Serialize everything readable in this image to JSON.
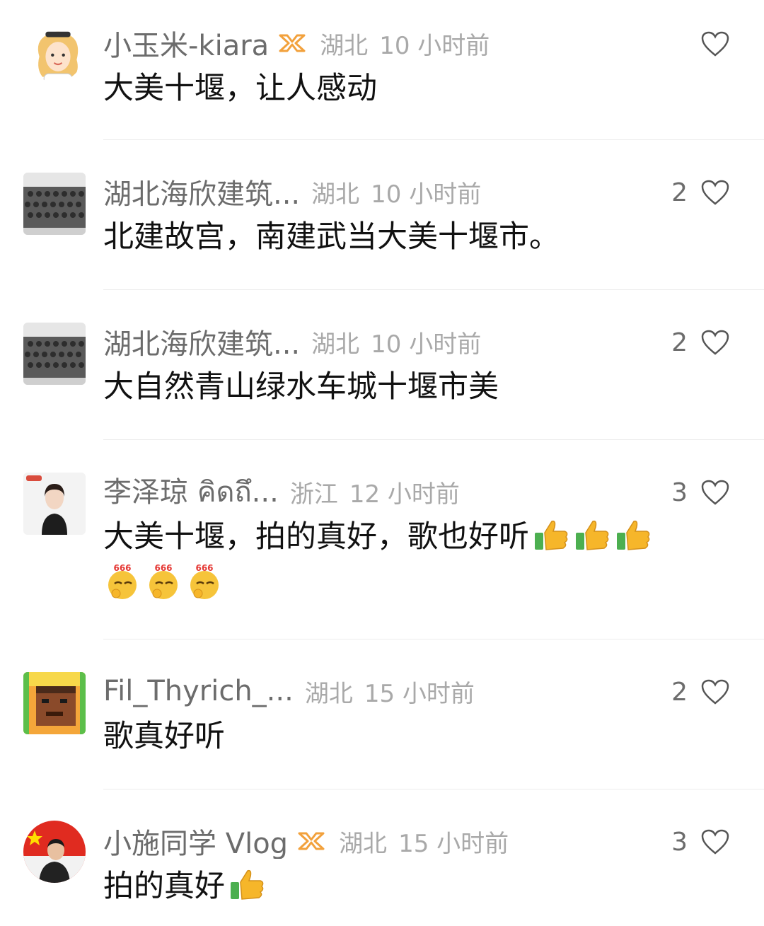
{
  "comments": [
    {
      "name": "小玉米-kiara",
      "verified": true,
      "location": "湖北",
      "time": "10 小时前",
      "text": "大美十堰，让人感动",
      "likes": "",
      "avatar_icon": "cartoon-girl-avatar"
    },
    {
      "name": "湖北海欣建筑...",
      "verified": false,
      "location": "湖北",
      "time": "10 小时前",
      "text": "北建故宫，南建武当大美十堰市。",
      "likes": "2",
      "avatar_icon": "group-photo-avatar"
    },
    {
      "name": "湖北海欣建筑...",
      "verified": false,
      "location": "湖北",
      "time": "10 小时前",
      "text": "大自然青山绿水车城十堰市美",
      "likes": "2",
      "avatar_icon": "group-photo-avatar"
    },
    {
      "name": "李泽琼 คิดถึ...",
      "verified": false,
      "location": "浙江",
      "time": "12 小时前",
      "text": "大美十堰，拍的真好，歌也好听",
      "likes": "3",
      "avatar_icon": "portrait-woman-avatar"
    },
    {
      "name": "Fil_Thyrich_...",
      "verified": false,
      "location": "湖北",
      "time": "15 小时前",
      "text": "歌真好听",
      "likes": "2",
      "avatar_icon": "pixel-art-avatar"
    },
    {
      "name": "小施同学 Vlog",
      "verified": true,
      "location": "湖北",
      "time": "15 小时前",
      "text": "拍的真好",
      "likes": "3",
      "avatar_icon": "man-flag-avatar"
    }
  ],
  "emoji": {
    "thumbs_up": "thumbs-up-emoji",
    "emoji_666": "666-emoji",
    "emoji_666_label": "666"
  },
  "colors": {
    "name": "#6c6c6c",
    "meta": "#a9a9a9",
    "text": "#111111",
    "verified": "#f2a13c",
    "divider": "#ececec"
  }
}
